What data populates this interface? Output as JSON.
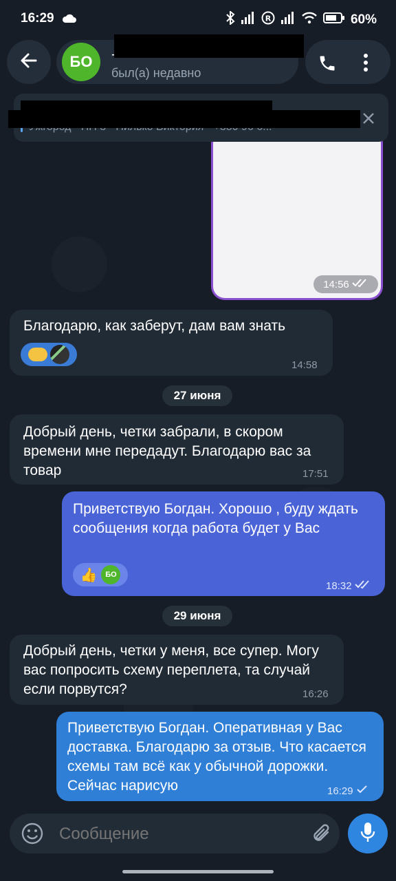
{
  "status_bar": {
    "time": "16:29",
    "battery": "60%"
  },
  "header": {
    "avatar_initials": "БО",
    "contact_name": "-",
    "contact_status": "был(а) недавно"
  },
  "pinned": {
    "text": "Ужгород · НП 3 · Пилько Виктория · +380 96 6..."
  },
  "messages": [
    {
      "time": "14:56"
    },
    {
      "text": "Благодарю, как заберут, дам вам знать",
      "time": "14:58"
    },
    {
      "date": "27 июня"
    },
    {
      "text": "Добрый день, четки забрали, в скором времени мне передадут. Благодарю вас за товар",
      "time": "17:51"
    },
    {
      "text": "Приветствую Богдан. Хорошо , буду ждать сообщения когда работа будет у Вас",
      "time": "18:32",
      "reaction_initials": "БО"
    },
    {
      "date": "29 июня"
    },
    {
      "text": "Добрый день, четки у меня, все супер. Могу вас попросить схему переплета, та случай если порвутся?",
      "time": "16:26"
    },
    {
      "text": "Приветствую Богдан. Оперативная у Вас доставка. Благодарю за отзыв. Что касается схемы там всё как у обычной дорожки. Сейчас нарисую",
      "time": "16:29"
    }
  ],
  "input": {
    "placeholder": "Сообщение"
  }
}
